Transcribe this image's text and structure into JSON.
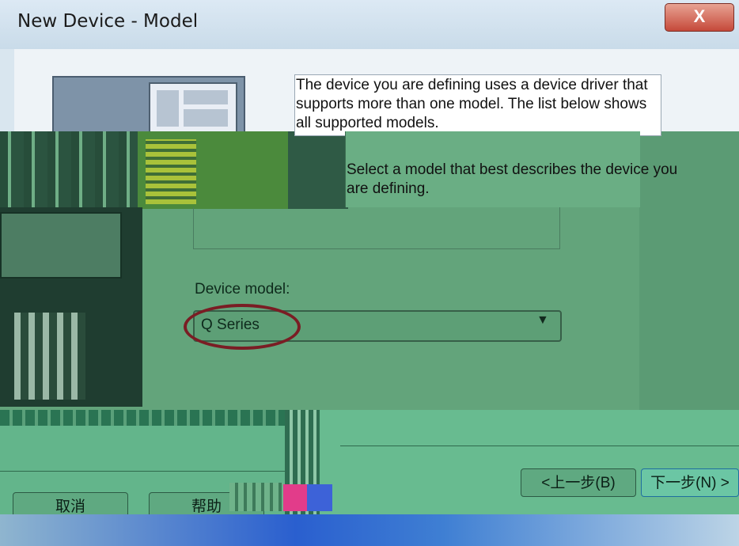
{
  "window": {
    "title": "New Device - Model",
    "close_label": "X"
  },
  "description": {
    "line1": "The device you are defining uses a device driver that supports more than one model. The list below shows all supported models.",
    "select_hint": "Select  a model that best describes the device you are defining."
  },
  "device_model": {
    "label": "Device model:",
    "selected": "Q Series"
  },
  "buttons": {
    "cancel": "取消",
    "help": "帮助",
    "back": "<上一步(B)",
    "next": "下一步(N) >"
  },
  "colors": {
    "highlight_ellipse": "#7a1d24"
  }
}
